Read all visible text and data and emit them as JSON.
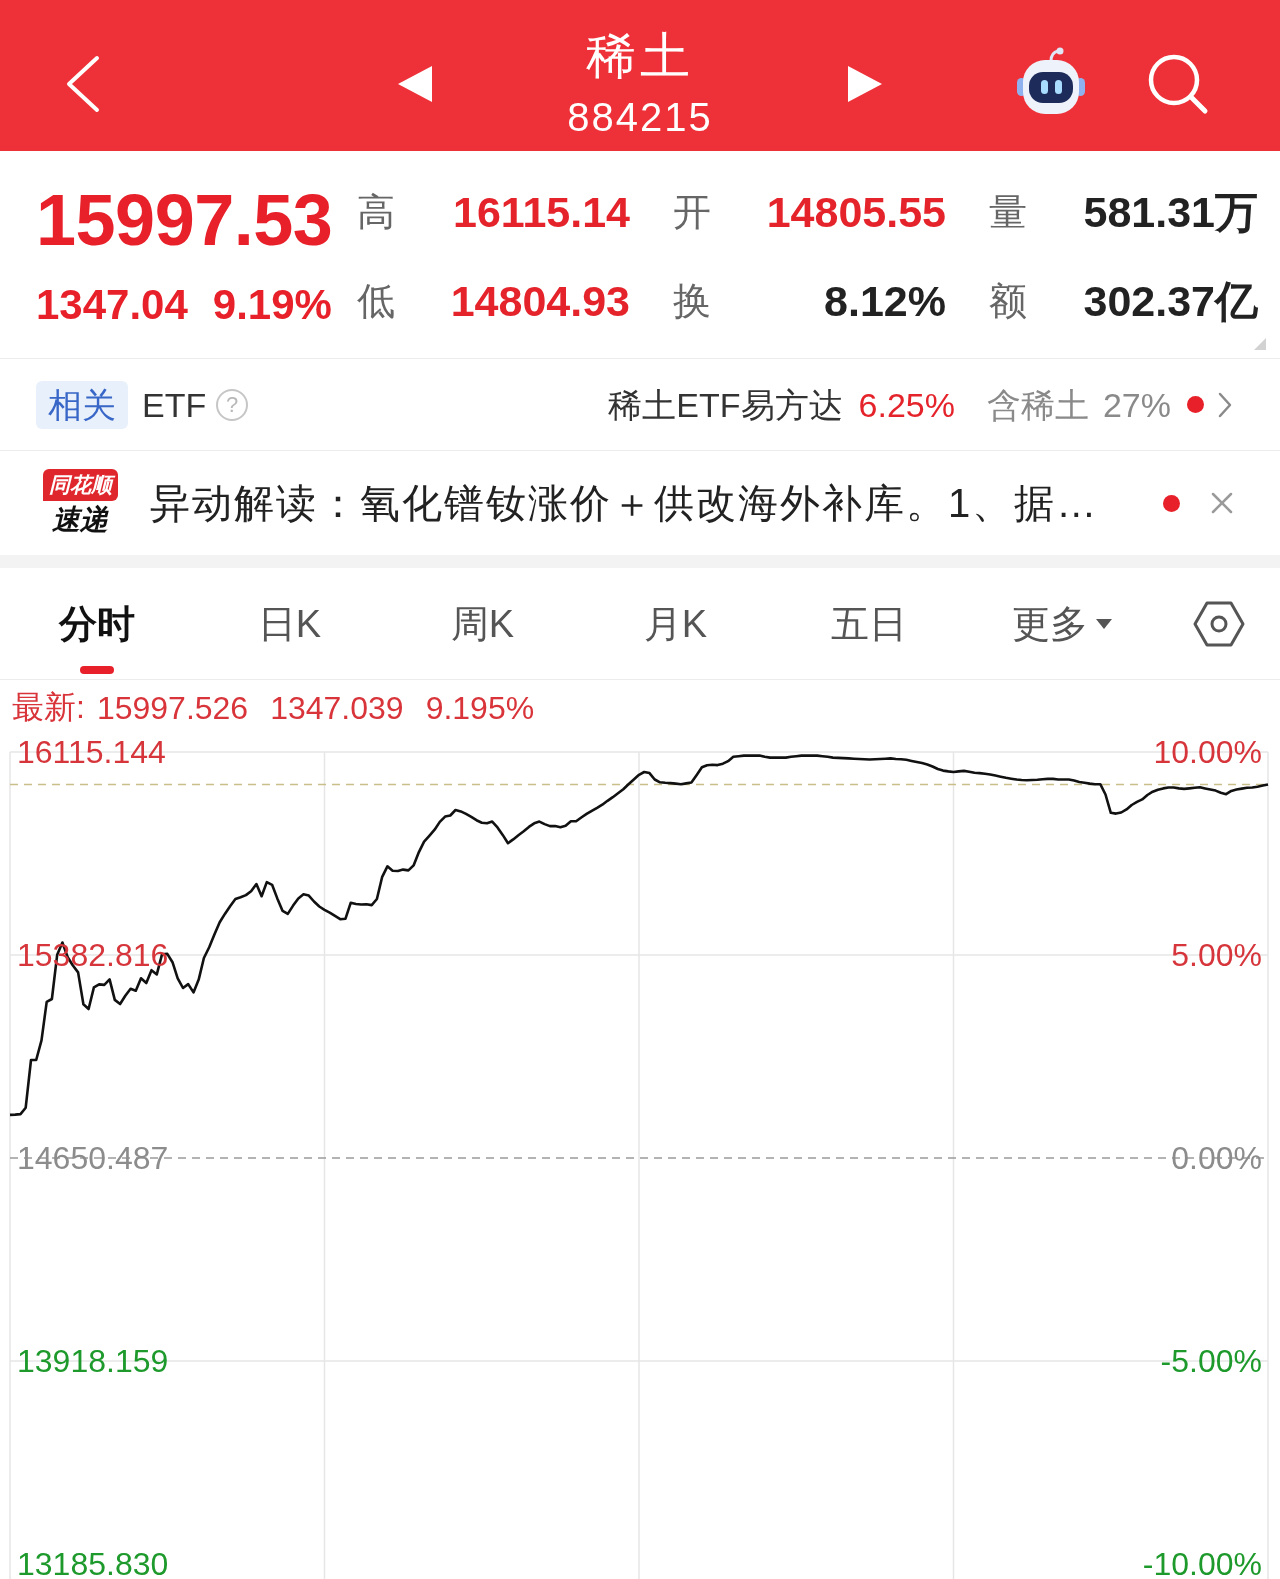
{
  "header": {
    "title": "稀土",
    "code": "884215"
  },
  "quote": {
    "price": "15997.53",
    "change": "1347.04",
    "change_pct": "9.19%",
    "fields": [
      {
        "label": "高",
        "value": "16115.14",
        "color": "#e5232b"
      },
      {
        "label": "开",
        "value": "14805.55",
        "color": "#e5232b"
      },
      {
        "label": "量",
        "value": "581.31万",
        "color": "#222222"
      },
      {
        "label": "低",
        "value": "14804.93",
        "color": "#e5232b"
      },
      {
        "label": "换",
        "value": "8.12%",
        "color": "#222222"
      },
      {
        "label": "额",
        "value": "302.37亿",
        "color": "#222222"
      }
    ]
  },
  "etf": {
    "tag": "相关",
    "label": "ETF",
    "help": "?",
    "fund": "稀土ETF易方达",
    "fund_change": "6.25%",
    "holding_label": "含稀土",
    "holding_pct": "27%",
    "unread": true
  },
  "news": {
    "source_top": "同花顺",
    "source_bottom": "速递",
    "text": "异动解读：氧化镨钕涨价＋供改海外补库。1、据…",
    "unread": true
  },
  "tabs": [
    {
      "label": "分时",
      "kind": "tab",
      "selected": true
    },
    {
      "label": "日K",
      "kind": "tab",
      "selected": false
    },
    {
      "label": "周K",
      "kind": "tab",
      "selected": false
    },
    {
      "label": "月K",
      "kind": "tab",
      "selected": false
    },
    {
      "label": "五日",
      "kind": "tab",
      "selected": false
    },
    {
      "label": "更多",
      "kind": "menu",
      "selected": false
    }
  ],
  "chart": {
    "latest_label": "最新:",
    "latest_values": [
      "15997.526",
      "1347.039",
      "9.195%"
    ],
    "percent_labels": [
      "10.00%",
      "5.00%",
      "0.00%",
      "-5.00%",
      "-10.00%"
    ],
    "chart_data": {
      "type": "line",
      "ylim": [
        13132,
        16115.144
      ],
      "yticks": [
        {
          "value": 16115.144,
          "label": "16115.144"
        },
        {
          "value": 15382.816,
          "label": "15382.816"
        },
        {
          "value": 14650.487,
          "label": "14650.487"
        },
        {
          "value": 13918.159,
          "label": "13918.159"
        },
        {
          "value": 13185.83,
          "label": "13185.830"
        }
      ],
      "ref_lines": [
        {
          "axis": "y",
          "value": 15997.526,
          "color": "#c9bf8a"
        },
        {
          "axis": "y",
          "value": 14650.487,
          "color": "#9a9a9a"
        }
      ],
      "categories": [
        null,
        null,
        null,
        null,
        null,
        null,
        null,
        null,
        null,
        null,
        null,
        null,
        null,
        null,
        null,
        null,
        null,
        null,
        null,
        null,
        null,
        null,
        null,
        null,
        null,
        null,
        null,
        null,
        null,
        null,
        null,
        null,
        null,
        null,
        null,
        null,
        null,
        null,
        null,
        null,
        null,
        null,
        null,
        null,
        null,
        null,
        null,
        null,
        null,
        null,
        null,
        null,
        null,
        null,
        null,
        null,
        null,
        null,
        null,
        null,
        null,
        null,
        null,
        null,
        null,
        null,
        null,
        null,
        null,
        null,
        null,
        null,
        null,
        null,
        null,
        null,
        null,
        null,
        null,
        null,
        null,
        null,
        null,
        null,
        null,
        null,
        null,
        null,
        null,
        null,
        null,
        null,
        null,
        null,
        null,
        null,
        null,
        null,
        null,
        null,
        null,
        null,
        null,
        null,
        null,
        null,
        null,
        null,
        null,
        null,
        null,
        null,
        null,
        null,
        null,
        null,
        null,
        null,
        null,
        null,
        null,
        null,
        null,
        null,
        null,
        null,
        null,
        null,
        null,
        null,
        null,
        null,
        null,
        null,
        null,
        null,
        null,
        null,
        null,
        null,
        null,
        null,
        null,
        null,
        null,
        null,
        null,
        null,
        null,
        null,
        null,
        null,
        null,
        null,
        null,
        null,
        null,
        null,
        null,
        null,
        null,
        null,
        null,
        null,
        null,
        null,
        null,
        null,
        null,
        null,
        null,
        null,
        null,
        null,
        null,
        null,
        null,
        null,
        null,
        null,
        null,
        null,
        null,
        null,
        null,
        null,
        null,
        null,
        null,
        null,
        null,
        null,
        null,
        null,
        null,
        null,
        null,
        null,
        null,
        null,
        null,
        null,
        null,
        null,
        null,
        null,
        null,
        null,
        null,
        null,
        null,
        null,
        null,
        null,
        null,
        null,
        null,
        null,
        null,
        null,
        null,
        null,
        null,
        null,
        null,
        null,
        null,
        null,
        null,
        null,
        null,
        null,
        null,
        null,
        null,
        null,
        null,
        null,
        null,
        null,
        null
      ],
      "values": [
        14806,
        14807,
        14809,
        14832,
        15004,
        15004,
        15075,
        15214,
        15224,
        15384,
        15428,
        15375,
        15345,
        15320,
        15205,
        15188,
        15266,
        15277,
        15275,
        15295,
        15221,
        15206,
        15236,
        15261,
        15254,
        15299,
        15282,
        15328,
        15313,
        15385,
        15387,
        15357,
        15299,
        15264,
        15278,
        15248,
        15294,
        15372,
        15411,
        15457,
        15501,
        15531,
        15559,
        15585,
        15591,
        15599,
        15613,
        15639,
        15595,
        15646,
        15636,
        15587,
        15542,
        15531,
        15561,
        15587,
        15602,
        15597,
        15576,
        15558,
        15546,
        15536,
        15524,
        15512,
        15514,
        15571,
        15567,
        15565,
        15566,
        15563,
        15585,
        15665,
        15703,
        15687,
        15686,
        15691,
        15688,
        15706,
        15754,
        15792,
        15813,
        15835,
        15863,
        15882,
        15886,
        15906,
        15901,
        15892,
        15881,
        15869,
        15860,
        15858,
        15864,
        15843,
        15816,
        15786,
        15800,
        15815,
        15829,
        15845,
        15858,
        15864,
        15855,
        15848,
        15848,
        15844,
        15849,
        15865,
        15865,
        15879,
        15892,
        15903,
        15914,
        15925,
        15939,
        15952,
        15966,
        15981,
        15999,
        16016,
        16033,
        16043,
        16039,
        16016,
        16006,
        16004,
        16003,
        16001,
        15999,
        16002,
        16005,
        16032,
        16060,
        16067,
        16069,
        16068,
        16073,
        16082,
        16098,
        16100,
        16102,
        16102,
        16102,
        16102,
        16098,
        16095,
        16095,
        16095,
        16095,
        16098,
        16100,
        16102,
        16102,
        16102,
        16102,
        16100,
        16098,
        16095,
        16094,
        16093,
        16092,
        16091,
        16090,
        16089,
        16088,
        16089,
        16090,
        16091,
        16092,
        16090,
        16089,
        16087,
        16083,
        16079,
        16075,
        16070,
        16063,
        16054,
        16048,
        16045,
        16043,
        16045,
        16047,
        16044,
        16040,
        16039,
        16037,
        16034,
        16030,
        16026,
        16022,
        16019,
        16016,
        16014,
        16013,
        16014,
        16015,
        16017,
        16018,
        16018,
        16016,
        16016,
        16016,
        16012,
        16007,
        16004,
        16001,
        15999,
        15999,
        15962,
        15896,
        15893,
        15897,
        15908,
        15924,
        15935,
        15944,
        15960,
        15972,
        15979,
        15984,
        15987,
        15987,
        15984,
        15982,
        15984,
        15986,
        15988,
        15984,
        15980,
        15976,
        15968,
        15963,
        15975,
        15980,
        15983,
        15986,
        15987,
        15990,
        15994,
        15998
      ]
    }
  }
}
